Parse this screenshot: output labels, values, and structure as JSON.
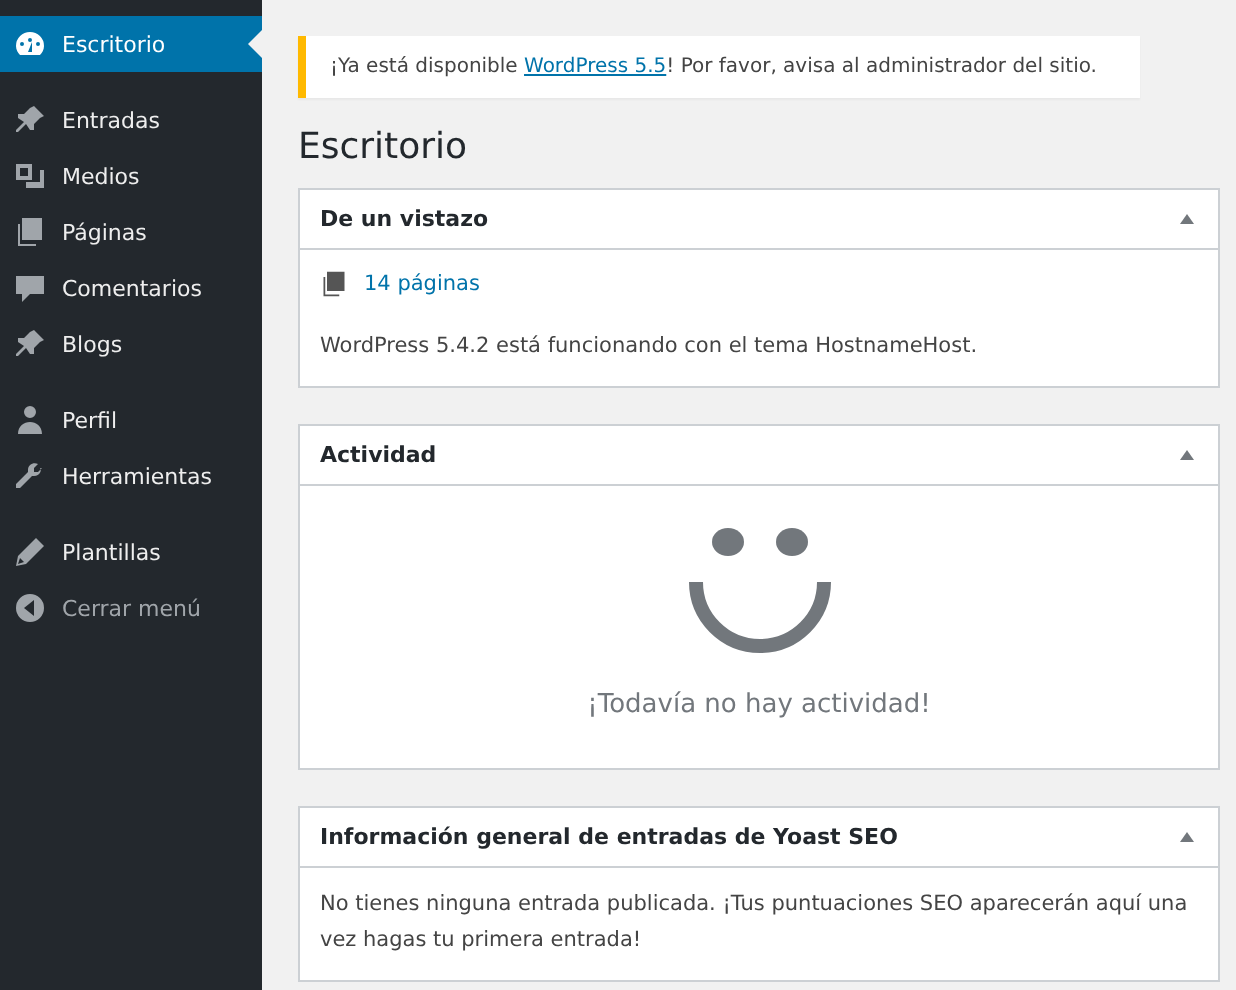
{
  "sidebar": {
    "groups": [
      [
        {
          "label": "Escritorio",
          "selected": true,
          "kind": "item"
        }
      ],
      [
        {
          "label": "Entradas",
          "selected": false,
          "kind": "item"
        },
        {
          "label": "Medios",
          "selected": false,
          "kind": "item"
        },
        {
          "label": "Páginas",
          "selected": false,
          "kind": "item"
        },
        {
          "label": "Comentarios",
          "selected": false,
          "kind": "item"
        },
        {
          "label": "Blogs",
          "selected": false,
          "kind": "item"
        }
      ],
      [
        {
          "label": "Perfil",
          "selected": false,
          "kind": "item"
        },
        {
          "label": "Herramientas",
          "selected": false,
          "kind": "item"
        }
      ],
      [
        {
          "label": "Plantillas",
          "selected": false,
          "kind": "item"
        },
        {
          "label": "Cerrar menú",
          "selected": false,
          "kind": "collapse"
        }
      ]
    ]
  },
  "notice": {
    "before": "¡Ya está disponible ",
    "link": "WordPress 5.5",
    "after": "! Por favor, avisa al administrador del sitio."
  },
  "page_title": "Escritorio",
  "panels": [
    {
      "title": "De un vistazo",
      "expanded": true,
      "kind": "glance",
      "count_link": "14 páginas",
      "text": "WordPress 5.4.2 está funcionando con el tema HostnameHost."
    },
    {
      "title": "Actividad",
      "expanded": true,
      "kind": "activity",
      "text": "¡Todavía no hay actividad!"
    },
    {
      "title": "Información general de entradas de Yoast SEO",
      "expanded": true,
      "kind": "text",
      "text": "No tienes ninguna entrada publicada. ¡Tus puntuaciones SEO aparecerán aquí una vez hagas tu primera entrada!"
    }
  ]
}
